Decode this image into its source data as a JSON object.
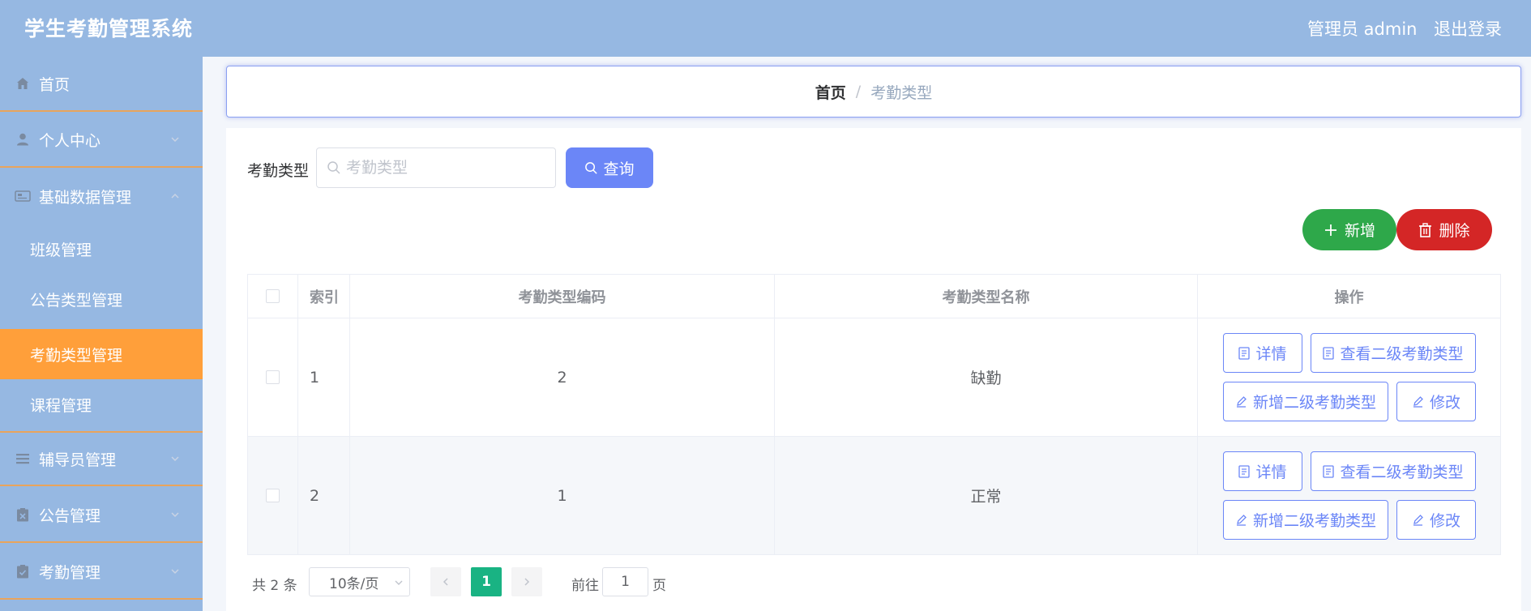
{
  "header": {
    "title": "学生考勤管理系统",
    "user": "管理员 admin",
    "logout": "退出登录"
  },
  "sidebar": {
    "home": "首页",
    "personal_center": "个人中心",
    "basic_data": "基础数据管理",
    "sub_items": [
      "班级管理",
      "公告类型管理",
      "考勤类型管理",
      "课程管理"
    ],
    "counselor": "辅导员管理",
    "notice": "公告管理",
    "attendance": "考勤管理",
    "active_sub": "考勤类型管理"
  },
  "breadcrumb": {
    "home": "首页",
    "separator": "/",
    "current": "考勤类型"
  },
  "search": {
    "label": "考勤类型",
    "placeholder": "考勤类型",
    "button": "查询"
  },
  "actions": {
    "add": "新增",
    "delete": "删除"
  },
  "table": {
    "headers": [
      "索引",
      "考勤类型编码",
      "考勤类型名称",
      "操作"
    ],
    "rows": [
      {
        "index": "1",
        "code": "2",
        "name": "缺勤"
      },
      {
        "index": "2",
        "code": "1",
        "name": "正常"
      }
    ],
    "ops": {
      "detail": "详情",
      "view_sub": "查看二级考勤类型",
      "add_sub": "新增二级考勤类型",
      "edit": "修改"
    }
  },
  "pagination": {
    "total": "共 2 条",
    "page_size": "10条/页",
    "current": "1",
    "goto": "前往",
    "goto_value": "1",
    "page_unit": "页"
  },
  "colors": {
    "header_bg": "#96b8e2",
    "active_menu": "#ff9f3a",
    "primary": "#6b86f7",
    "add": "#2ea84a",
    "delete": "#d42626",
    "page_active": "#19b383"
  },
  "icons": [
    "home-icon",
    "user-icon",
    "id-card-icon",
    "list-icon",
    "clipboard-x-icon",
    "clipboard-check-icon",
    "search-icon",
    "plus-icon",
    "trash-icon",
    "document-icon",
    "edit-icon",
    "chevron-down-icon",
    "chevron-up-icon",
    "chevron-left-icon",
    "chevron-right-icon"
  ]
}
